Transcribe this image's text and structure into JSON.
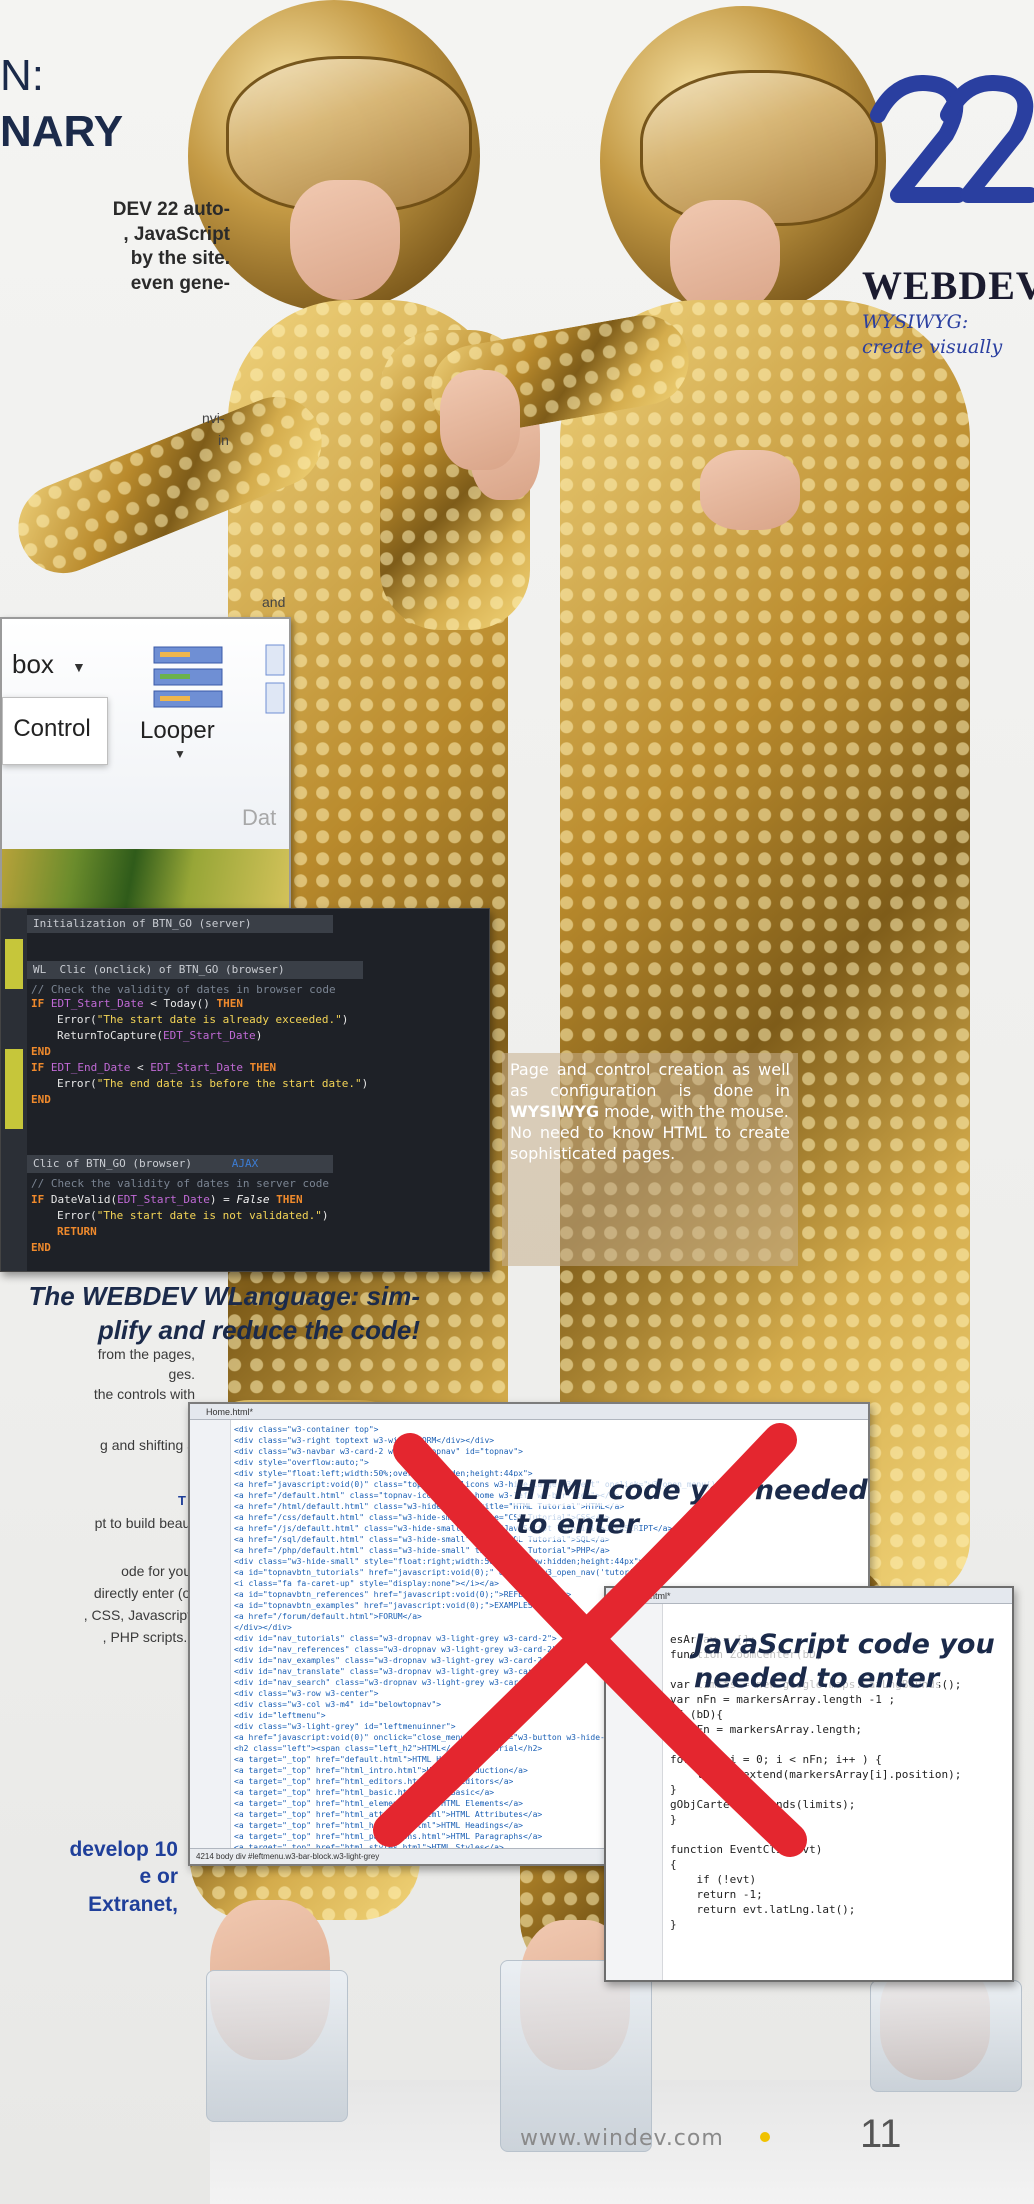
{
  "headline": {
    "line1": "N:",
    "line2": "NARY"
  },
  "intro": "DEV 22 auto-\n, JavaScript\nby the site.\neven gene-",
  "fragments": {
    "envi": "nvi-",
    "in": "in",
    "and": "and"
  },
  "logo": {
    "number": "22",
    "wordmark": "WEBDEV",
    "tagline": "WYSIWYG: create visually",
    "colors": {
      "blue": "#2a3fa0",
      "wordmark": "#1b1b2f"
    }
  },
  "ribbon": {
    "combo": "box",
    "control": "Control",
    "looper": "Looper",
    "data": "Dat"
  },
  "code_editor": {
    "proc1": "Initialization of BTN_GO (server)",
    "proc2": "WL  Clic (onclick) of BTN_GO (browser)",
    "proc3": "Clic of BTN_GO (browser)",
    "proc3_tag": "AJAX",
    "l1": "// Check the validity of dates in browser code",
    "l2_kw": "IF",
    "l2_var": "EDT_Start_Date",
    "l2_rest": " < Today() ",
    "l2_then": "THEN",
    "l3_fn": "Error(",
    "l3_str": "\"The start date is already exceeded.\"",
    "l3_end": ")",
    "l4": "ReturnToCapture(",
    "l4_var": "EDT_Start_Date",
    "l4_end": ")",
    "l5": "END",
    "l6_kw": "IF",
    "l6_var1": "EDT_End_Date",
    "l6_mid": " < ",
    "l6_var2": "EDT_Start_Date",
    "l6_then": " THEN",
    "l7_fn": "Error(",
    "l7_str": "\"The end date is before the start date.\"",
    "l7_end": ")",
    "l8": "END",
    "l9": "// Check the validity of dates in server code",
    "l10_kw": "IF",
    "l10_fn": " DateValid(",
    "l10_var": "EDT_Start_Date",
    "l10_mid": ") = ",
    "l10_false": "False",
    "l10_then": " THEN",
    "l11_fn": "Error(",
    "l11_str": "\"The start date is not validated.\"",
    "l11_end": ")",
    "l12": "RETURN",
    "l13": "END"
  },
  "code_caption": "The WEBDEV WLanguage: sim-\nplify and reduce the code!",
  "callout": {
    "text1": "Page and control creation as well as configuration is done in ",
    "bold": "WYSIWYG",
    "text2": " mode, with the mouse.",
    "text3": "No need to know HTML to create sophisticated pages."
  },
  "body": {
    "f1": "from the pages,",
    "f2": "ges.",
    "f3": "the controls with",
    "f4": "g and shifting a",
    "f5_head": "T",
    "f6": "pt to build beau-",
    "f7": "ode for you.",
    "f8": "directly enter (or",
    "f9": ", CSS, Javascript,",
    "f10": ", PHP scripts...",
    "lead": "develop 10\ne or\nExtranet,"
  },
  "html_window": {
    "title": "Home.html*",
    "label1": "HTML code you needed",
    "label2": "to enter",
    "status": "4214    body    div  #leftmenu.w3-bar-block.w3-light-grey"
  },
  "js_window": {
    "title": "Digest.html*",
    "label1": "JavaScript code you",
    "label2": "needed to enter"
  },
  "footer": {
    "url": "www.windev.com",
    "page": "11"
  }
}
